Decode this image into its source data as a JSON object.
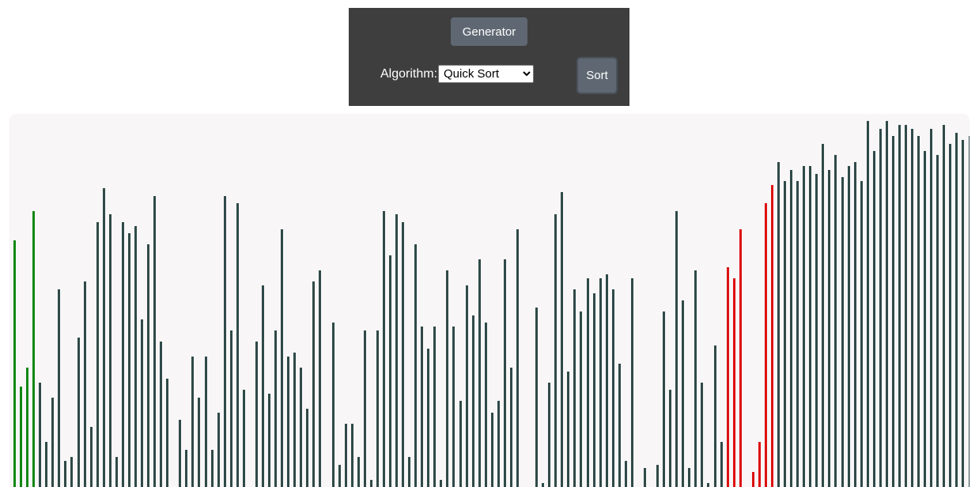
{
  "controls": {
    "generator_label": "Generator",
    "algorithm_label": "Algorithm:",
    "algorithm_options": [
      "Quick Sort"
    ],
    "algorithm_selected": "Quick Sort",
    "sort_label": "Sort"
  },
  "colors": {
    "default": "#2f4a48",
    "sorted": "#118811",
    "compare": "#dd1111",
    "panel_background": "#f8f6f7",
    "control_background": "#3e3e3e",
    "button_background": "#5f6872"
  },
  "chart_data": {
    "type": "bar",
    "values": [
      0.66,
      0.27,
      0.32,
      0.74,
      0.28,
      0.12,
      0.24,
      0.53,
      0.07,
      0.08,
      0.4,
      0.55,
      0.16,
      0.71,
      0.8,
      0.73,
      0.08,
      0.71,
      0.68,
      0.7,
      0.45,
      0.65,
      0.78,
      0.39,
      0.29,
      0.0,
      0.18,
      0.1,
      0.35,
      0.24,
      0.35,
      0.1,
      0.2,
      0.78,
      0.42,
      0.76,
      0.26,
      0.0,
      0.39,
      0.54,
      0.25,
      0.42,
      0.69,
      0.35,
      0.36,
      0.32,
      0.21,
      0.55,
      0.58,
      0.0,
      0.44,
      0.06,
      0.17,
      0.17,
      0.08,
      0.42,
      0.02,
      0.42,
      0.74,
      0.62,
      0.73,
      0.71,
      0.08,
      0.65,
      0.43,
      0.37,
      0.43,
      0.02,
      0.58,
      0.43,
      0.23,
      0.54,
      0.46,
      0.61,
      0.44,
      0.2,
      0.23,
      0.61,
      0.32,
      0.69,
      0.0,
      0.0,
      0.48,
      0.01,
      0.28,
      0.73,
      0.79,
      0.31,
      0.53,
      0.47,
      0.56,
      0.52,
      0.56,
      0.57,
      0.53,
      0.33,
      0.07,
      0.56,
      0.0,
      0.05,
      0.0,
      0.06,
      0.47,
      0.26,
      0.74,
      0.5,
      0.05,
      0.58,
      0.28,
      0.01,
      0.38,
      0.12,
      0.59,
      0.56,
      0.69,
      0.0,
      0.04,
      0.12,
      0.76,
      0.81,
      0.87,
      0.82,
      0.85,
      0.82,
      0.86,
      0.86,
      0.84,
      0.92,
      0.85,
      0.89,
      0.83,
      0.86,
      0.87,
      0.82,
      0.98,
      0.9,
      0.96,
      0.98,
      0.94,
      0.97,
      0.97,
      0.96,
      0.94,
      0.9,
      0.96,
      0.89,
      0.97,
      0.92,
      0.95,
      0.93,
      0.94,
      0.94
    ],
    "colors": [
      "sorted",
      "sorted",
      "sorted",
      "sorted",
      "default",
      "default",
      "default",
      "default",
      "default",
      "default",
      "default",
      "default",
      "default",
      "default",
      "default",
      "default",
      "default",
      "default",
      "default",
      "default",
      "default",
      "default",
      "default",
      "default",
      "default",
      "default",
      "default",
      "default",
      "default",
      "default",
      "default",
      "default",
      "default",
      "default",
      "default",
      "default",
      "default",
      "default",
      "default",
      "default",
      "default",
      "default",
      "default",
      "default",
      "default",
      "default",
      "default",
      "default",
      "default",
      "default",
      "default",
      "default",
      "default",
      "default",
      "default",
      "default",
      "default",
      "default",
      "default",
      "default",
      "default",
      "default",
      "default",
      "default",
      "default",
      "default",
      "default",
      "default",
      "default",
      "default",
      "default",
      "default",
      "default",
      "default",
      "default",
      "default",
      "default",
      "default",
      "default",
      "default",
      "default",
      "default",
      "default",
      "default",
      "default",
      "default",
      "default",
      "default",
      "default",
      "default",
      "default",
      "default",
      "default",
      "default",
      "default",
      "default",
      "default",
      "default",
      "default",
      "default",
      "default",
      "default",
      "default",
      "default",
      "default",
      "default",
      "default",
      "default",
      "default",
      "default",
      "default",
      "default",
      "compare",
      "compare",
      "compare",
      "compare",
      "compare",
      "compare",
      "compare",
      "compare",
      "default",
      "default",
      "default",
      "default",
      "default",
      "default",
      "default",
      "default",
      "default",
      "default",
      "default",
      "default",
      "default",
      "default",
      "default",
      "default",
      "default",
      "default",
      "default",
      "default",
      "default",
      "default",
      "default",
      "default",
      "default",
      "default",
      "default",
      "default",
      "default",
      "default",
      "default",
      "default"
    ],
    "ylim": [
      0,
      1
    ]
  }
}
